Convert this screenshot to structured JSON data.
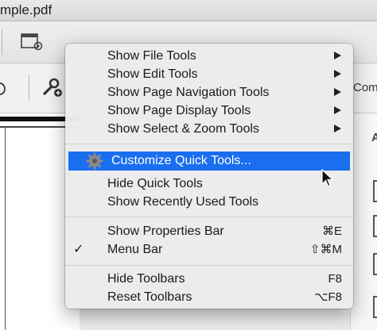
{
  "window": {
    "title": "mple.pdf"
  },
  "toolbar": {
    "comment_label": "Com"
  },
  "right_panel": {
    "header_letter": "A"
  },
  "menu": {
    "items": [
      {
        "label": "Show File Tools",
        "submenu": true
      },
      {
        "label": "Show Edit Tools",
        "submenu": true
      },
      {
        "label": "Show Page Navigation Tools",
        "submenu": true
      },
      {
        "label": "Show Page Display Tools",
        "submenu": true
      },
      {
        "label": "Show Select & Zoom Tools",
        "submenu": true
      },
      {
        "label": "Customize Quick Tools...",
        "highlighted": true,
        "icon": "gear-icon"
      },
      {
        "label": "Hide Quick Tools"
      },
      {
        "label": "Show Recently Used Tools"
      },
      {
        "label": "Show Properties Bar",
        "shortcut": "⌘E"
      },
      {
        "label": "Menu Bar",
        "checked": true,
        "check_mark": "✓",
        "shortcut": "⇧⌘M"
      },
      {
        "label": "Hide Toolbars",
        "shortcut": "F8"
      },
      {
        "label": "Reset Toolbars",
        "shortcut": "⌥F8"
      }
    ]
  },
  "colors": {
    "highlight": "#1a6ef0",
    "menu_background": "#ececec",
    "text": "#1a1a1a",
    "gear": "#8a8a8a"
  }
}
